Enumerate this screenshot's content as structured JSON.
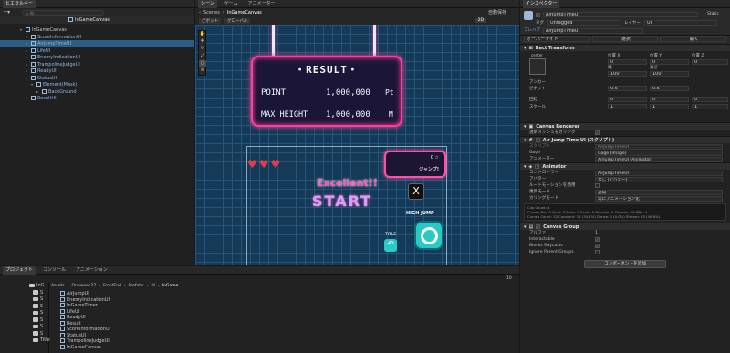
{
  "hierarchy": {
    "tab": "ヒエラルキー",
    "search_placeholder": "All",
    "scene_name": "InGameCanvas",
    "items": [
      {
        "label": "InGameCanvas",
        "depth": 0
      },
      {
        "label": "ScoreInformationUI",
        "depth": 1
      },
      {
        "label": "AirJumpTimeUI",
        "depth": 1
      },
      {
        "label": "LifeUI",
        "depth": 1
      },
      {
        "label": "EnemyIndicationUI",
        "depth": 1
      },
      {
        "label": "TrampolineJudgeUI",
        "depth": 1
      },
      {
        "label": "ReadyUI",
        "depth": 1
      },
      {
        "label": "StatusUI",
        "depth": 1
      },
      {
        "label": "Element(Mask)",
        "depth": 2
      },
      {
        "label": "BackGround",
        "depth": 3
      },
      {
        "label": "ResultUI",
        "depth": 1
      }
    ]
  },
  "scene": {
    "tabs": [
      "シーン",
      "ゲーム",
      "アニメーター"
    ],
    "breadcrumb_root": "Scenes",
    "breadcrumb_name": "InGameCanvas",
    "autosave": "自動保存",
    "toolbar": {
      "pivot": "ピボット",
      "global": "グローバル",
      "mode": "2D"
    },
    "result": {
      "title": "・RESULT・",
      "point_label": "POINT",
      "point_value": "1,000,000",
      "point_unit": "Pt",
      "height_label": "MAX HEIGHT",
      "height_value": "1,000,000",
      "height_unit": "M"
    },
    "game": {
      "excellent": "Excellent!!",
      "start": "START",
      "combo_count": "0 ☆",
      "bubble_text": "ジャンプ!",
      "timer_label": "HIGH JUMP",
      "title_label": "TITLE",
      "close_glyph": "X"
    }
  },
  "inspector": {
    "tab": "インスペクター",
    "object_name": "AirJumpTimeUI",
    "static_label": "Static",
    "tag_label": "タグ",
    "tag_value": "Untagged",
    "layer_label": "レイヤー",
    "layer_value": "UI",
    "prefab_label": "プレハブ",
    "prefab_value": "AirJumpTimeUI",
    "override_label": "オーバーライド",
    "select_label": "選択",
    "open_label": "開く",
    "rect": {
      "title": "Rect Transform",
      "anchor_mode": "center",
      "pos_x_label": "位置 X",
      "pos_y_label": "位置 Y",
      "pos_z_label": "位置 Z",
      "pos_x": "0",
      "pos_y": "0",
      "pos_z": "0",
      "width_label": "幅",
      "height_label": "高さ",
      "width": "100",
      "height": "100",
      "anchor_label": "アンカー",
      "pivot_label": "ピボット",
      "pivot_x": "0.5",
      "pivot_y": "0.5",
      "rotation_label": "回転",
      "rot_x": "0",
      "rot_y": "0",
      "rot_z": "0",
      "scale_label": "スケール",
      "scale_x": "1",
      "scale_y": "1",
      "scale_z": "1"
    },
    "canvas_renderer": {
      "title": "Canvas Renderer",
      "cull_label": "透明メッシュをカリング"
    },
    "script": {
      "title": "Air Jump Time UI (スクリプト)",
      "script_label": "スクリプト",
      "script_value": "AirJumpTimeUI",
      "gage_label": "Gage",
      "gage_value": "Gage (Image)",
      "animator_label": "アニメーター",
      "animator_value": "AirJumpTimeUI (Animator)"
    },
    "animator": {
      "title": "Animator",
      "controller_label": "コントローラー",
      "controller_value": "AirJumpTimeUI",
      "avatar_label": "アバター",
      "avatar_value": "なし (アバター)",
      "root_motion_label": "ルートモーションを適用",
      "update_label": "更新モード",
      "update_value": "通常",
      "culling_label": "カリングモード",
      "culling_value": "常にアニメーション化",
      "info_lines": [
        "Clip Count: 4",
        "Curves Pos: 0 Quat: 0 Euler: 0 Scale: 0 Muscles: 0 Generic: 28 PPtr: 4",
        "Curves Count: 32 Constant: 15 (34.4%) Dense: 0 (0.0%) Stream: 15 (46.8%)"
      ]
    },
    "canvas_group": {
      "title": "Canvas Group",
      "alpha_label": "アルファ",
      "alpha_value": "1",
      "interactable_label": "Interactable",
      "blocks_label": "Blocks Raycasts",
      "ignore_label": "Ignore Parent Groups"
    },
    "add_component": "コンポーネントを追加"
  },
  "project": {
    "tabs": [
      "プロジェクト",
      "コンソール",
      "アニメーション"
    ],
    "path": [
      "Assets",
      "Oneweek27",
      "FrontEnd",
      "Prefabs",
      "UI",
      "InGame"
    ],
    "tree_items": [
      "InG",
      "S",
      "S",
      "S",
      "S",
      "S",
      "S",
      "S",
      "Title"
    ],
    "files": [
      "AirJumpUI",
      "EnemyIndicationUI",
      "InGameTimer",
      "LifeUI",
      "ReadyUI",
      "Result",
      "ScoreInformationUI",
      "StatusUI",
      "TrampolineJudgeUI",
      "InGameCanvas"
    ],
    "file_count": "10"
  },
  "colors": {
    "accent": "#2c5d87",
    "neon_pink": "#ff3e9a",
    "scene_bg": "#143a57"
  }
}
